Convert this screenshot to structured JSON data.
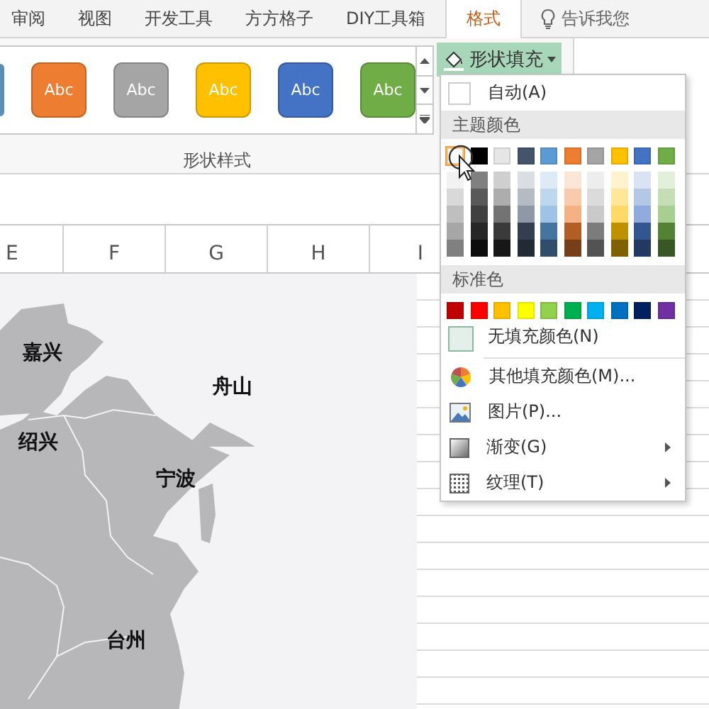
{
  "tabs": [
    {
      "label": "审阅",
      "selected": false
    },
    {
      "label": "视图",
      "selected": false
    },
    {
      "label": "开发工具",
      "selected": false
    },
    {
      "label": "方方格子",
      "selected": false
    },
    {
      "label": "DIY工具箱",
      "selected": false
    },
    {
      "label": "格式",
      "selected": true
    }
  ],
  "search": {
    "placeholder": "告诉我您"
  },
  "shape_styles": [
    {
      "label": "Abc",
      "color": "#ed7d31"
    },
    {
      "label": "Abc",
      "color": "#a5a5a5"
    },
    {
      "label": "Abc",
      "color": "#ffc000"
    },
    {
      "label": "Abc",
      "color": "#4472c4"
    },
    {
      "label": "Abc",
      "color": "#70ad47"
    }
  ],
  "group_label": "形状样式",
  "fill_button": {
    "label": "形状填充",
    "expanded": true
  },
  "columns": [
    "E",
    "F",
    "G",
    "H",
    "I"
  ],
  "map_labels": [
    "嘉兴",
    "绍兴",
    "舟山",
    "宁波",
    "台州"
  ],
  "fill_menu": {
    "auto": "自动(A)",
    "theme_header": "主题颜色",
    "theme_colors": [
      {
        "color": "#ffffff",
        "selected": true
      },
      {
        "color": "#000000",
        "selected": false
      },
      {
        "color": "#e7e6e6",
        "selected": false
      },
      {
        "color": "#44546a",
        "selected": false
      },
      {
        "color": "#5b9bd5",
        "selected": false
      },
      {
        "color": "#ed7d31",
        "selected": false
      },
      {
        "color": "#a5a5a5",
        "selected": false
      },
      {
        "color": "#ffc000",
        "selected": false
      },
      {
        "color": "#4472c4",
        "selected": false
      },
      {
        "color": "#70ad47",
        "selected": false
      }
    ],
    "standard_header": "标准色",
    "standard_colors": [
      {
        "color": "#c00000"
      },
      {
        "color": "#ff0000"
      },
      {
        "color": "#ffc000"
      },
      {
        "color": "#ffff00"
      },
      {
        "color": "#92d050"
      },
      {
        "color": "#00b050"
      },
      {
        "color": "#00b0f0"
      },
      {
        "color": "#0070c0"
      },
      {
        "color": "#002060"
      },
      {
        "color": "#7030a0"
      }
    ],
    "items": [
      {
        "kind": "no_fill",
        "label": "无填充颜色(N)",
        "submenu": false
      },
      {
        "kind": "more_colors",
        "label": "其他填充颜色(M)...",
        "submenu": false
      },
      {
        "kind": "picture",
        "label": "图片(P)...",
        "submenu": false
      },
      {
        "kind": "gradient",
        "label": "渐变(G)",
        "submenu": true
      },
      {
        "kind": "texture",
        "label": "纹理(T)",
        "submenu": true
      }
    ]
  }
}
